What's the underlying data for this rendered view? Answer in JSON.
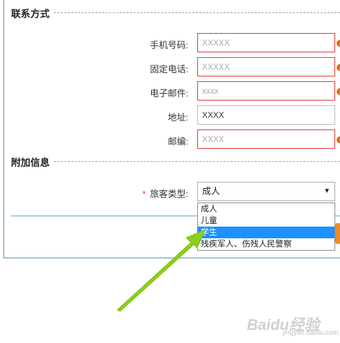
{
  "contact": {
    "title": "联系方式",
    "fields": [
      {
        "label": "手机号码:",
        "placeholder": "XXXXX"
      },
      {
        "label": "固定电话:",
        "placeholder": "XXXXX"
      },
      {
        "label": "电子邮件:",
        "placeholder": "xxxx"
      },
      {
        "label": "地址:",
        "value": "XXXX"
      },
      {
        "label": "邮编:",
        "placeholder": "XXXX"
      }
    ]
  },
  "extra": {
    "title": "附加信息",
    "passenger_type": {
      "required_mark": "*",
      "label": "旅客类型:",
      "selected": "成人",
      "options": [
        "成人",
        "儿童",
        "学生",
        "残疾军人、伤残人民警察"
      ],
      "highlighted": "学生"
    }
  },
  "watermark": {
    "text": "Baidu经验",
    "sub": "jingyan.baidu.com"
  },
  "colors": {
    "error_border": "#dd3333",
    "accent_dot": "#e86a1c",
    "highlight": "#1e90ff",
    "arrow": "#8ccf1a"
  }
}
